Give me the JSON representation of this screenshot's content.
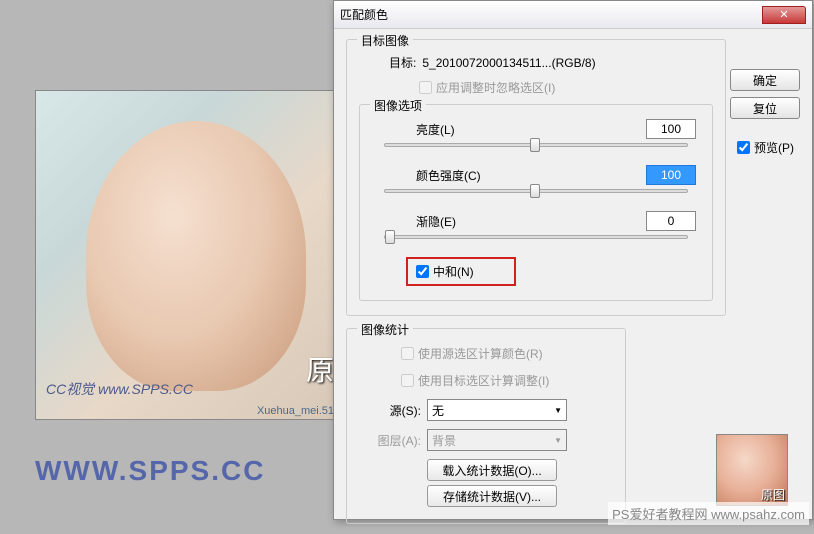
{
  "dialog": {
    "title": "匹配颜色",
    "ok_label": "确定",
    "reset_label": "复位",
    "preview_label": "预览(P)",
    "close_symbol": "✕"
  },
  "target_image": {
    "legend": "目标图像",
    "target_label": "目标:",
    "target_value": "5_2010072000134511...(RGB/8)",
    "ignore_selection_label": "应用调整时忽略选区(I)"
  },
  "image_options": {
    "legend": "图像选项",
    "brightness": {
      "label": "亮度(L)",
      "value": "100",
      "pos": 48
    },
    "intensity": {
      "label": "颜色强度(C)",
      "value": "100",
      "pos": 48
    },
    "fade": {
      "label": "渐隐(E)",
      "value": "0",
      "pos": 0
    },
    "neutralize_label": "中和(N)"
  },
  "image_stats": {
    "legend": "图像统计",
    "use_source_selection_label": "使用源选区计算颜色(R)",
    "use_target_selection_label": "使用目标选区计算调整(I)",
    "source_label": "源(S):",
    "source_value": "无",
    "layer_label": "图层(A):",
    "layer_value": "背景",
    "load_stats_label": "载入统计数据(O)...",
    "save_stats_label": "存储统计数据(V)..."
  },
  "canvas": {
    "cc_watermark": "CC视觉 www.SPPS.CC",
    "yuan": "原",
    "xuehua": "Xuehua_mei.51",
    "thumb_yuan": "原图"
  },
  "page": {
    "url": "WWW.SPPS.CC",
    "footer": "PS爱好者教程网\nwww.psahz.com"
  }
}
